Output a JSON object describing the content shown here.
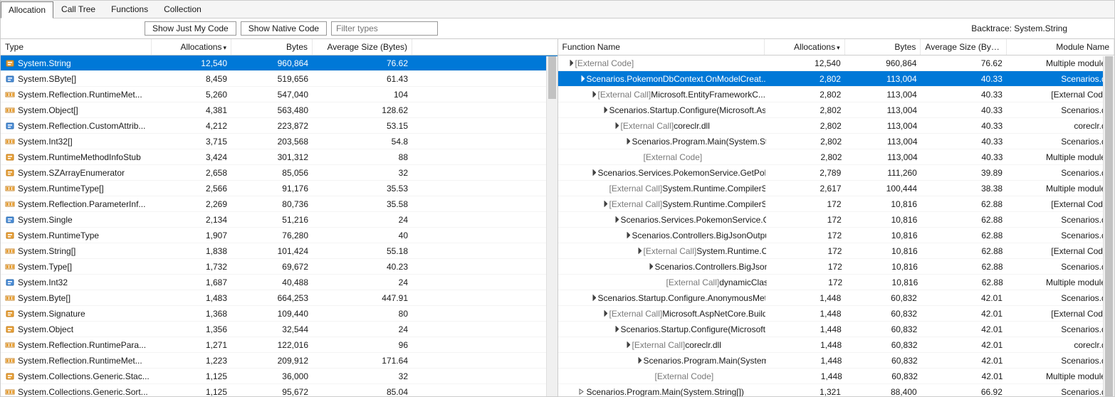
{
  "tabs": [
    "Allocation",
    "Call Tree",
    "Functions",
    "Collection"
  ],
  "selectedTab": 0,
  "toolbar": {
    "show_just_my_code": "Show Just My Code",
    "show_native_code": "Show Native Code",
    "filter_placeholder": "Filter types"
  },
  "backtrace_label": "Backtrace: System.String",
  "leftHeaders": [
    "Type",
    "Allocations",
    "Bytes",
    "Average Size (Bytes)"
  ],
  "rightHeaders": [
    "Function Name",
    "Allocations",
    "Bytes",
    "Average Size (Bytes)",
    "Module Name"
  ],
  "colors": {
    "selection": "#0078d7"
  },
  "chart_data": {
    "type": "table",
    "left_sort": "Allocations desc",
    "right_sort": "Allocations desc"
  },
  "leftRows": [
    {
      "icon": "class",
      "name": "System.String",
      "alloc": "12,540",
      "bytes": "960,864",
      "avg": "76.62",
      "selected": true
    },
    {
      "icon": "struct",
      "name": "System.SByte[]",
      "alloc": "8,459",
      "bytes": "519,656",
      "avg": "61.43"
    },
    {
      "icon": "array",
      "name": "System.Reflection.RuntimeMet...",
      "alloc": "5,260",
      "bytes": "547,040",
      "avg": "104"
    },
    {
      "icon": "array",
      "name": "System.Object[]",
      "alloc": "4,381",
      "bytes": "563,480",
      "avg": "128.62"
    },
    {
      "icon": "struct",
      "name": "System.Reflection.CustomAttrib...",
      "alloc": "4,212",
      "bytes": "223,872",
      "avg": "53.15"
    },
    {
      "icon": "array",
      "name": "System.Int32[]",
      "alloc": "3,715",
      "bytes": "203,568",
      "avg": "54.8"
    },
    {
      "icon": "class",
      "name": "System.RuntimeMethodInfoStub",
      "alloc": "3,424",
      "bytes": "301,312",
      "avg": "88"
    },
    {
      "icon": "class",
      "name": "System.SZArrayEnumerator",
      "alloc": "2,658",
      "bytes": "85,056",
      "avg": "32"
    },
    {
      "icon": "array",
      "name": "System.RuntimeType[]",
      "alloc": "2,566",
      "bytes": "91,176",
      "avg": "35.53"
    },
    {
      "icon": "array",
      "name": "System.Reflection.ParameterInf...",
      "alloc": "2,269",
      "bytes": "80,736",
      "avg": "35.58"
    },
    {
      "icon": "struct",
      "name": "System.Single",
      "alloc": "2,134",
      "bytes": "51,216",
      "avg": "24"
    },
    {
      "icon": "class",
      "name": "System.RuntimeType",
      "alloc": "1,907",
      "bytes": "76,280",
      "avg": "40"
    },
    {
      "icon": "array",
      "name": "System.String[]",
      "alloc": "1,838",
      "bytes": "101,424",
      "avg": "55.18"
    },
    {
      "icon": "array",
      "name": "System.Type[]",
      "alloc": "1,732",
      "bytes": "69,672",
      "avg": "40.23"
    },
    {
      "icon": "struct",
      "name": "System.Int32",
      "alloc": "1,687",
      "bytes": "40,488",
      "avg": "24"
    },
    {
      "icon": "array",
      "name": "System.Byte[]",
      "alloc": "1,483",
      "bytes": "664,253",
      "avg": "447.91"
    },
    {
      "icon": "class",
      "name": "System.Signature",
      "alloc": "1,368",
      "bytes": "109,440",
      "avg": "80"
    },
    {
      "icon": "class",
      "name": "System.Object",
      "alloc": "1,356",
      "bytes": "32,544",
      "avg": "24"
    },
    {
      "icon": "array",
      "name": "System.Reflection.RuntimePara...",
      "alloc": "1,271",
      "bytes": "122,016",
      "avg": "96"
    },
    {
      "icon": "array",
      "name": "System.Reflection.RuntimeMet...",
      "alloc": "1,223",
      "bytes": "209,912",
      "avg": "171.64"
    },
    {
      "icon": "class",
      "name": "System.Collections.Generic.Stac...",
      "alloc": "1,125",
      "bytes": "36,000",
      "avg": "32"
    },
    {
      "icon": "array",
      "name": "System.Collections.Generic.Sort...",
      "alloc": "1,125",
      "bytes": "95,672",
      "avg": "85.04"
    }
  ],
  "rightRows": [
    {
      "indent": 0,
      "toggle": "open",
      "ext": true,
      "name": "[External Code]",
      "alloc": "12,540",
      "bytes": "960,864",
      "avg": "76.62",
      "module": "Multiple modules"
    },
    {
      "indent": 1,
      "toggle": "open",
      "name": "Scenarios.PokemonDbContext.OnModelCreat...",
      "alloc": "2,802",
      "bytes": "113,004",
      "avg": "40.33",
      "module": "Scenarios.dll",
      "selected": true
    },
    {
      "indent": 2,
      "toggle": "open",
      "ext": true,
      "extPrefix": "[External Call] ",
      "name": "Microsoft.EntityFrameworkC...",
      "alloc": "2,802",
      "bytes": "113,004",
      "avg": "40.33",
      "module": "[External Code]"
    },
    {
      "indent": 3,
      "toggle": "open",
      "name": "Scenarios.Startup.Configure(Microsoft.As...",
      "alloc": "2,802",
      "bytes": "113,004",
      "avg": "40.33",
      "module": "Scenarios.dll"
    },
    {
      "indent": 4,
      "toggle": "open",
      "ext": true,
      "extPrefix": "[External Call] ",
      "name": "coreclr.dll",
      "alloc": "2,802",
      "bytes": "113,004",
      "avg": "40.33",
      "module": "coreclr.dll"
    },
    {
      "indent": 5,
      "toggle": "open",
      "name": "Scenarios.Program.Main(System.Stri...",
      "alloc": "2,802",
      "bytes": "113,004",
      "avg": "40.33",
      "module": "Scenarios.dll"
    },
    {
      "indent": 6,
      "toggle": "none",
      "ext": true,
      "name": "[External Code]",
      "alloc": "2,802",
      "bytes": "113,004",
      "avg": "40.33",
      "module": "Multiple modules"
    },
    {
      "indent": 2,
      "toggle": "open",
      "name": "Scenarios.Services.PokemonService.GetPoke...",
      "alloc": "2,789",
      "bytes": "111,260",
      "avg": "39.89",
      "module": "Scenarios.dll"
    },
    {
      "indent": 3,
      "toggle": "none",
      "ext": true,
      "extPrefix": "[External Call] ",
      "name": "System.Runtime.CompilerSer...",
      "alloc": "2,617",
      "bytes": "100,444",
      "avg": "38.38",
      "module": "Multiple modules"
    },
    {
      "indent": 3,
      "toggle": "open",
      "ext": true,
      "extPrefix": "[External Call] ",
      "name": "System.Runtime.CompilerSer...",
      "alloc": "172",
      "bytes": "10,816",
      "avg": "62.88",
      "module": "[External Code]"
    },
    {
      "indent": 4,
      "toggle": "open",
      "name": "Scenarios.Services.PokemonService.GetP...",
      "alloc": "172",
      "bytes": "10,816",
      "avg": "62.88",
      "module": "Scenarios.dll"
    },
    {
      "indent": 5,
      "toggle": "open",
      "name": "Scenarios.Controllers.BigJsonOutputC...",
      "alloc": "172",
      "bytes": "10,816",
      "avg": "62.88",
      "module": "Scenarios.dll"
    },
    {
      "indent": 6,
      "toggle": "open",
      "ext": true,
      "extPrefix": "[External Call] ",
      "name": "System.Runtime.Com...",
      "alloc": "172",
      "bytes": "10,816",
      "avg": "62.88",
      "module": "[External Code]"
    },
    {
      "indent": 7,
      "toggle": "open",
      "name": "Scenarios.Controllers.BigJsonOutp...",
      "alloc": "172",
      "bytes": "10,816",
      "avg": "62.88",
      "module": "Scenarios.dll"
    },
    {
      "indent": 8,
      "toggle": "none",
      "ext": true,
      "extPrefix": "[External Call] ",
      "name": "dynamicClass.lam...",
      "alloc": "172",
      "bytes": "10,816",
      "avg": "62.88",
      "module": "Multiple modules"
    },
    {
      "indent": 2,
      "toggle": "open",
      "name": "Scenarios.Startup.Configure.AnonymousMeth...",
      "alloc": "1,448",
      "bytes": "60,832",
      "avg": "42.01",
      "module": "Scenarios.dll"
    },
    {
      "indent": 3,
      "toggle": "open",
      "ext": true,
      "extPrefix": "[External Call] ",
      "name": "Microsoft.AspNetCore.Builde...",
      "alloc": "1,448",
      "bytes": "60,832",
      "avg": "42.01",
      "module": "[External Code]"
    },
    {
      "indent": 4,
      "toggle": "open",
      "name": "Scenarios.Startup.Configure(Microsoft.As...",
      "alloc": "1,448",
      "bytes": "60,832",
      "avg": "42.01",
      "module": "Scenarios.dll"
    },
    {
      "indent": 5,
      "toggle": "open",
      "ext": true,
      "extPrefix": "[External Call] ",
      "name": "coreclr.dll",
      "alloc": "1,448",
      "bytes": "60,832",
      "avg": "42.01",
      "module": "coreclr.dll"
    },
    {
      "indent": 6,
      "toggle": "open",
      "name": "Scenarios.Program.Main(System.Stri...",
      "alloc": "1,448",
      "bytes": "60,832",
      "avg": "42.01",
      "module": "Scenarios.dll"
    },
    {
      "indent": 7,
      "toggle": "none",
      "ext": true,
      "name": "[External Code]",
      "alloc": "1,448",
      "bytes": "60,832",
      "avg": "42.01",
      "module": "Multiple modules"
    },
    {
      "indent": 1,
      "toggle": "closed",
      "name": "Scenarios.Program.Main(System.String[])",
      "alloc": "1,321",
      "bytes": "88,400",
      "avg": "66.92",
      "module": "Scenarios.dll"
    }
  ]
}
